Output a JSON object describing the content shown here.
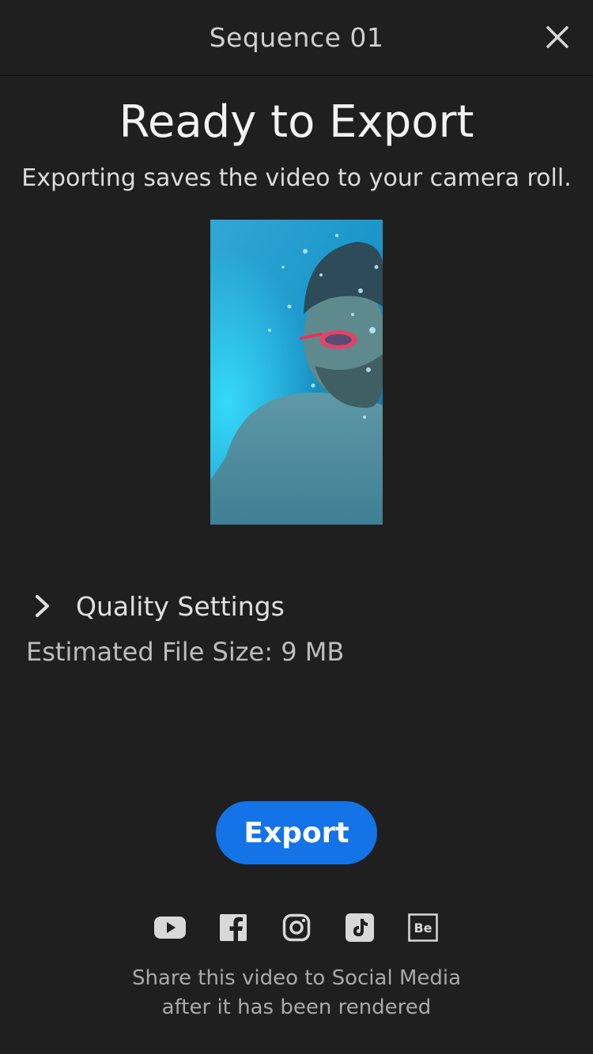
{
  "header": {
    "title": "Sequence 01",
    "close_icon": "close-icon"
  },
  "main": {
    "headline": "Ready to Export",
    "subtitle": "Exporting saves the video to your camera roll.",
    "preview_description": "video-thumbnail"
  },
  "settings": {
    "quality_label": "Quality Settings",
    "chevron_icon": "chevron-right-icon",
    "file_size_text": "Estimated File Size: 9 MB"
  },
  "actions": {
    "export_label": "Export"
  },
  "social": {
    "icons": [
      "youtube-icon",
      "facebook-icon",
      "instagram-icon",
      "tiktok-icon",
      "behance-icon"
    ],
    "behance_label": "Be",
    "share_line1": "Share this video to Social Media",
    "share_line2": "after it has been rendered"
  },
  "colors": {
    "background": "#1f1f1f",
    "accent": "#1473e6",
    "text_primary": "#f2f2f2",
    "text_secondary": "#a9a9a9"
  }
}
